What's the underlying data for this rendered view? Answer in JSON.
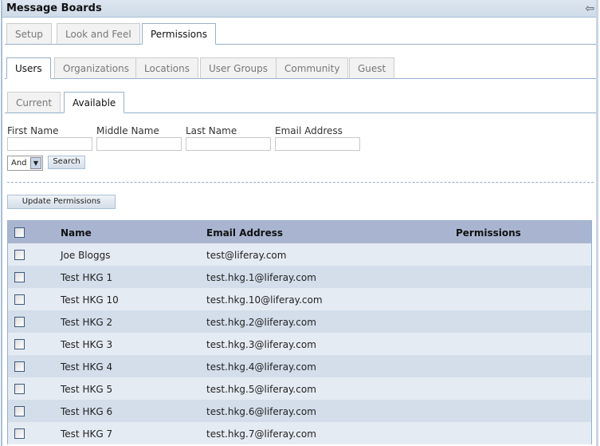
{
  "title": "Message Boards",
  "tabs1": [
    "Setup",
    "Look and Feel",
    "Permissions"
  ],
  "tabs2": [
    "Users",
    "Organizations",
    "Locations",
    "User Groups",
    "Community",
    "Guest"
  ],
  "tabs3": [
    "Current",
    "Available"
  ],
  "search": {
    "labels": [
      "First Name",
      "Middle Name",
      "Last Name",
      "Email Address"
    ],
    "operator": "And",
    "search_label": "Search"
  },
  "update_label": "Update Permissions",
  "table": {
    "headers": [
      "Name",
      "Email Address",
      "Permissions"
    ],
    "rows": [
      [
        "Joe Bloggs",
        "test@liferay.com"
      ],
      [
        "Test HKG 1",
        "test.hkg.1@liferay.com"
      ],
      [
        "Test HKG 10",
        "test.hkg.10@liferay.com"
      ],
      [
        "Test HKG 2",
        "test.hkg.2@liferay.com"
      ],
      [
        "Test HKG 3",
        "test.hkg.3@liferay.com"
      ],
      [
        "Test HKG 4",
        "test.hkg.4@liferay.com"
      ],
      [
        "Test HKG 5",
        "test.hkg.5@liferay.com"
      ],
      [
        "Test HKG 6",
        "test.hkg.6@liferay.com"
      ],
      [
        "Test HKG 7",
        "test.hkg.7@liferay.com"
      ]
    ]
  }
}
